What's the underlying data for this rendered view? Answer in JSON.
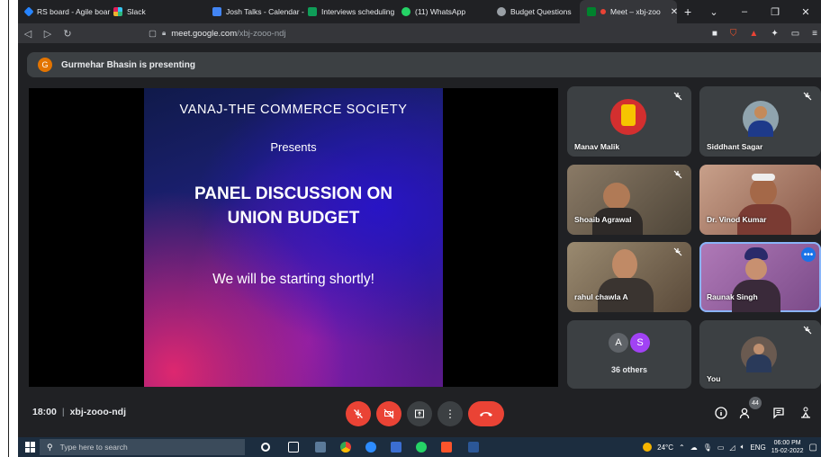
{
  "browser": {
    "tabs": [
      {
        "label": "RS board - Agile boar",
        "color": "#2684ff"
      },
      {
        "label": "Slack",
        "color": "#e01e5a"
      },
      {
        "label": "Josh Talks - Calendar -",
        "color": "#4285f4"
      },
      {
        "label": "Interviews scheduling",
        "color": "#0f9d58"
      },
      {
        "label": "(11) WhatsApp",
        "color": "#25d366"
      },
      {
        "label": "Budget Questions",
        "color": "#9aa0a6"
      },
      {
        "label": "Meet – xbj-zoo",
        "color": "#00832d",
        "active": true
      }
    ],
    "url_host": "meet.google.com",
    "url_path": "/xbj-zooo-ndj"
  },
  "presenter_banner": {
    "avatar_letter": "G",
    "text": "Gurmehar Bhasin is presenting"
  },
  "slide": {
    "title": "VANAJ-THE COMMERCE SOCIETY",
    "presents": "Presents",
    "heading_line1": "PANEL DISCUSSION ON",
    "heading_line2": "UNION BUDGET",
    "subtitle": "We will be starting shortly!"
  },
  "participants": [
    {
      "name": "Manav Malik",
      "muted": true
    },
    {
      "name": "Siddhant Sagar",
      "muted": true
    },
    {
      "name": "Shoaib Agrawal",
      "muted": true
    },
    {
      "name": "Dr. Vinod Kumar",
      "muted": false
    },
    {
      "name": "rahul chawla A",
      "muted": true
    },
    {
      "name": "Raunak Singh",
      "muted": false
    },
    {
      "name": "You",
      "muted": true
    }
  ],
  "others": {
    "initial_1": "A",
    "initial_2": "S",
    "label": "36 others"
  },
  "meeting": {
    "time": "18:00",
    "code": "xbj-zooo-ndj",
    "participant_count": "44"
  },
  "taskbar": {
    "search_placeholder": "Type here to search",
    "weather": "24°C",
    "lang": "ENG",
    "time": "06:00 PM",
    "date": "15-02-2022"
  },
  "colors": {
    "meet_bg": "#202124",
    "tile_bg": "#3c4043",
    "red": "#ea4335",
    "accent": "#8ab4f8"
  }
}
